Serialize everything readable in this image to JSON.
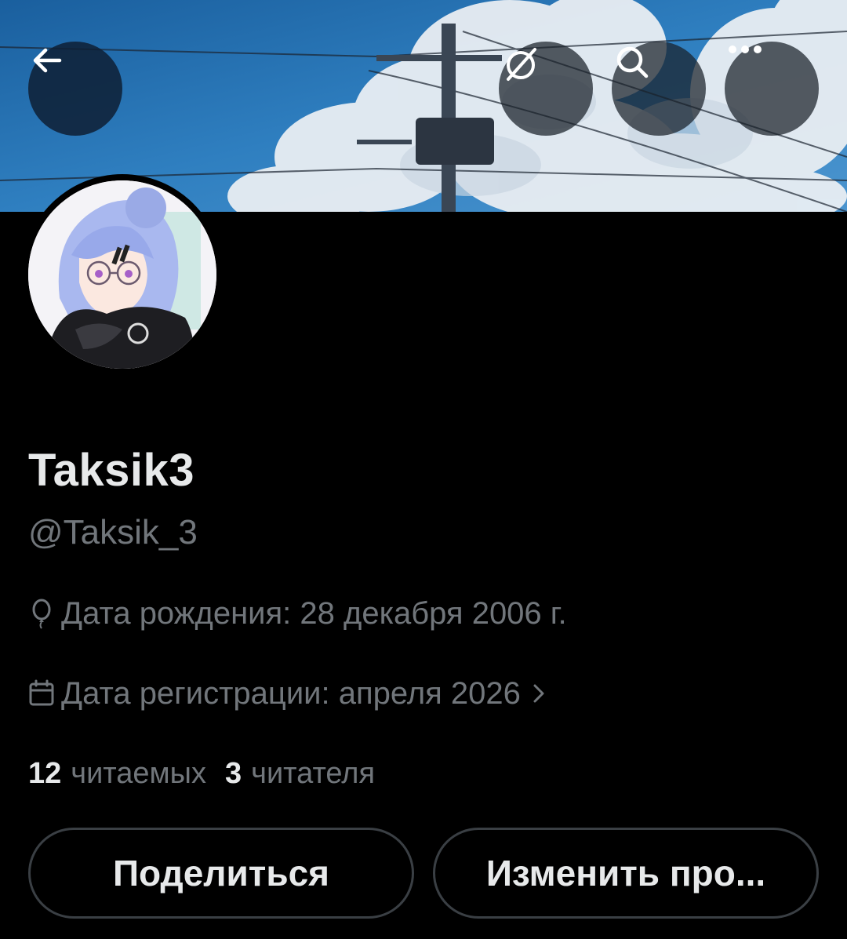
{
  "header": {
    "back_icon": "arrow-left-icon",
    "hide_icon": "eye-slash-circle-icon",
    "search_icon": "search-icon",
    "more_icon": "more-horizontal-icon"
  },
  "profile": {
    "display_name": "Taksik3",
    "handle": "@Taksik_3",
    "birthday": "Дата рождения: 28 декабря 2006 г.",
    "joined": "Дата регистрации: апреля 2026",
    "following_count": "12",
    "following_label": "читаемых",
    "followers_count": "3",
    "followers_label": "читателя"
  },
  "actions": {
    "share_label": "Поделиться",
    "edit_label": "Изменить про..."
  },
  "colors": {
    "background": "#000000",
    "primary_text": "#e7e9ea",
    "secondary_text": "#71767b",
    "button_border": "#3a3f44",
    "sky": "#2a7bbd"
  }
}
